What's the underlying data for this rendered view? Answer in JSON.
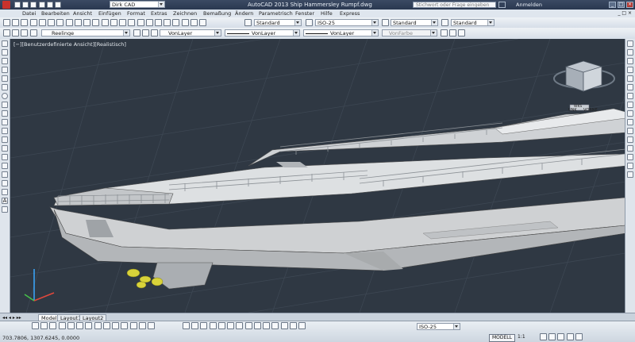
{
  "app": {
    "title": "AutoCAD 2013   Ship Hammersley Rumpf.dwg",
    "workspace": "Dirk CAD",
    "search_placeholder": "Stichwort oder Frage eingeben",
    "signin": "Anmelden"
  },
  "menu": [
    "Datei",
    "Bearbeiten",
    "Ansicht",
    "Einfügen",
    "Format",
    "Extras",
    "Zeichnen",
    "Bemaßung",
    "Ändern",
    "Parametrisch",
    "Fenster",
    "Hilfe",
    "Express"
  ],
  "styles": {
    "text_style": "Standard",
    "dim_style": "ISO-25",
    "table_style": "Standard",
    "multileader_style": "Standard"
  },
  "layers": {
    "current_layer": "Reelinge",
    "color": "VonLayer",
    "linetype": "VonLayer",
    "lineweight": "VonLayer",
    "plotstyle": "VonFarbe"
  },
  "viewport": {
    "label": "[−][Benutzerdefinierte Ansicht][Realistisch]",
    "viewcube_left": "UNK",
    "viewcube_front": "VORNE",
    "wcs": "WKS"
  },
  "tabs": [
    "Modell",
    "Layout1",
    "Layout2"
  ],
  "status": {
    "coordinates": "703.7806, 1307.6245, 0.0000",
    "mode": "MODELL",
    "annotation_scale": "1:1",
    "dim_style_bottom": "ISO-25"
  }
}
